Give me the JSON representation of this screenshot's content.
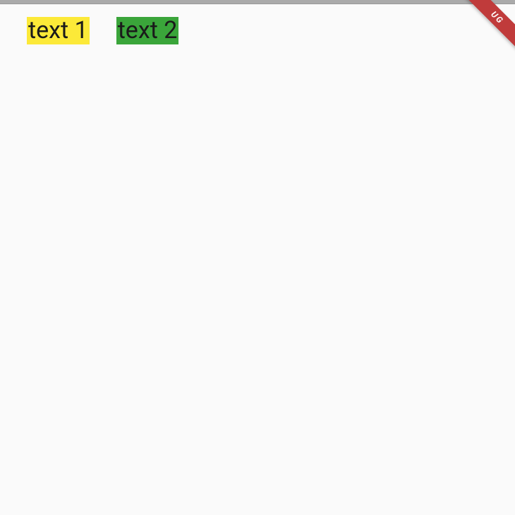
{
  "texts": {
    "first": "text 1",
    "second": "text 2"
  },
  "debug_banner_label": "UG",
  "colors": {
    "yellow": "#fce938",
    "green": "#3aa53a",
    "ribbon": "#c03b3b"
  }
}
